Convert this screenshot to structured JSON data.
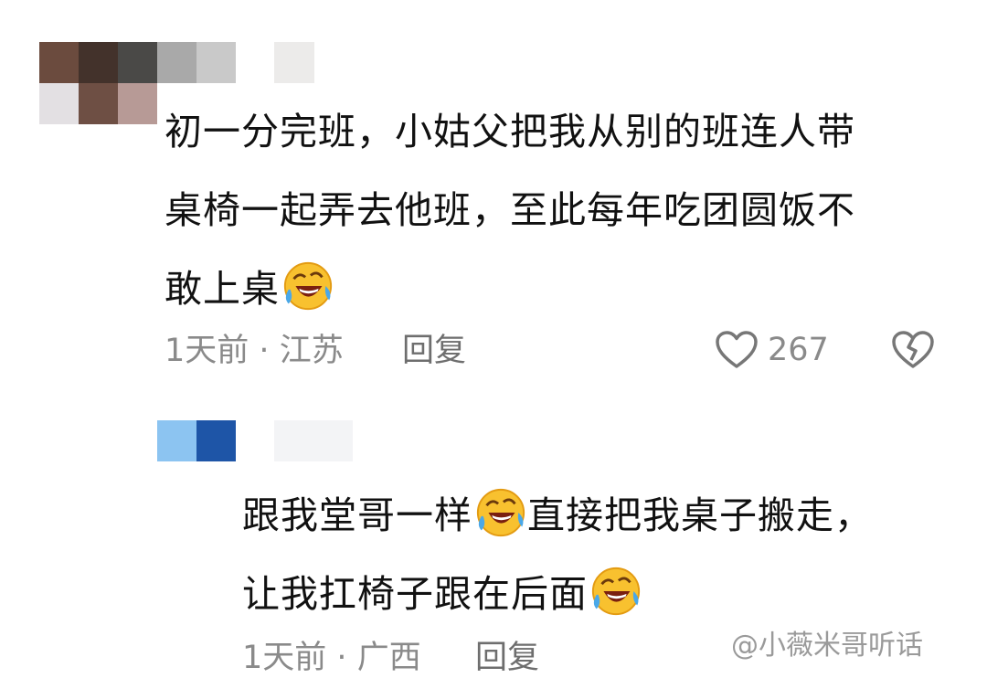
{
  "comments": [
    {
      "avatar_colors": [
        "#6b4b3e",
        "#43322b",
        "#4a4947",
        "#a9a9a9",
        "#d4d4d4",
        "#ecebea",
        "#e3e0e3",
        "#6e4f44",
        "#b79a96"
      ],
      "text_lines": [
        "初一分完班，小姑父把我从别的班连人带",
        "桌椅一起弄去他班，至此每年吃团圆饭不",
        "敢上桌"
      ],
      "emoji": "laughing-crying-emoji",
      "time": "1天前",
      "separator": "·",
      "location": "江苏",
      "reply_label": "回复",
      "likes": "267"
    },
    {
      "avatar_colors": [
        "#8cc4f1",
        "#1e55a7",
        "#ffffff",
        "#f2f4f7",
        "#f7f7f8"
      ],
      "text_parts": [
        "跟我堂哥一样",
        "直接把我桌子搬走，",
        "让我扛椅子跟在后面"
      ],
      "emoji": "laughing-crying-emoji",
      "time": "1天前",
      "separator": "·",
      "location": "广西",
      "reply_label": "回复"
    }
  ],
  "watermark": "@小薇米哥听话"
}
